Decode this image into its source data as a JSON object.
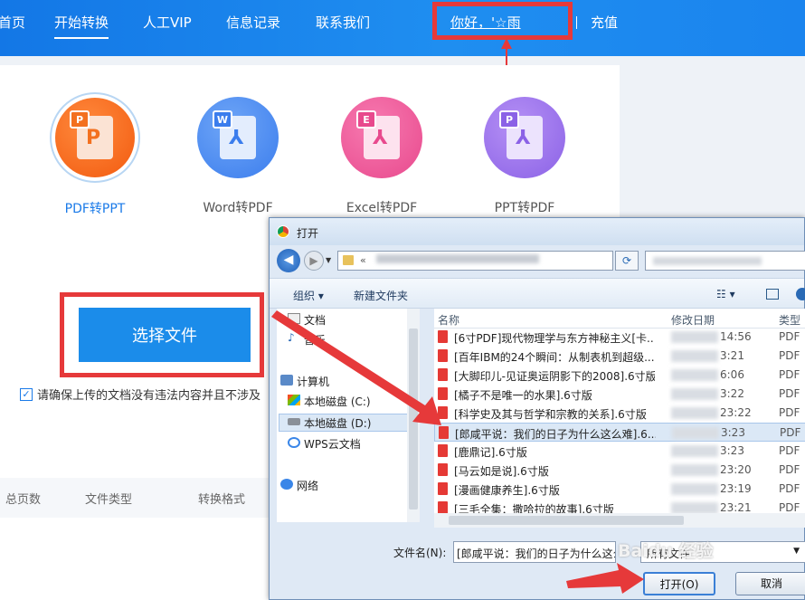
{
  "nav": {
    "items": [
      "首页",
      "开始转换",
      "人工VIP",
      "信息记录",
      "联系我们"
    ],
    "greeting": "你好，'☆雨",
    "recharge": "充值"
  },
  "converters": [
    {
      "label": "PDF转PPT",
      "badge": "P"
    },
    {
      "label": "Word转PDF",
      "badge": "W"
    },
    {
      "label": "Excel转PDF",
      "badge": "E"
    },
    {
      "label": "PPT转PDF",
      "badge": "P"
    }
  ],
  "select_button": "选择文件",
  "agree_text": "请确保上传的文档没有违法内容并且不涉及",
  "table_headers": [
    "总页数",
    "文件类型",
    "转换格式"
  ],
  "dialog": {
    "title": "打开",
    "path_prefix": "«",
    "toolbar": {
      "organize": "组织 ▾",
      "new_folder": "新建文件夹"
    },
    "nav_items": [
      "文档",
      "音乐",
      "计算机",
      "本地磁盘 (C:)",
      "本地磁盘 (D:)",
      "WPS云文档",
      "网络"
    ],
    "columns": [
      "名称",
      "修改日期",
      "类型"
    ],
    "files": [
      {
        "name": "[6寸PDF]现代物理学与东方神秘主义[卡...",
        "date": "14:56",
        "type": "PDF"
      },
      {
        "name": "[百年IBM的24个瞬间：从制表机到超级...",
        "date": "3:21",
        "type": "PDF"
      },
      {
        "name": "[大脚印儿-见证奥运阴影下的2008].6寸版",
        "date": "6:06",
        "type": "PDF"
      },
      {
        "name": "[橘子不是唯一的水果].6寸版",
        "date": "3:22",
        "type": "PDF"
      },
      {
        "name": "[科学史及其与哲学和宗教的关系].6寸版",
        "date": "23:22",
        "type": "PDF"
      },
      {
        "name": "[郎咸平说：我们的日子为什么这么难].6...",
        "date": "3:23",
        "type": "PDF"
      },
      {
        "name": "[鹿鼎记].6寸版",
        "date": "3:23",
        "type": "PDF"
      },
      {
        "name": "[马云如是说].6寸版",
        "date": "23:20",
        "type": "PDF"
      },
      {
        "name": "[漫画健康养生].6寸版",
        "date": "23:19",
        "type": "PDF"
      },
      {
        "name": "[三毛全集：撒哈拉的故事].6寸版",
        "date": "23:21",
        "type": "PDF"
      }
    ],
    "filename_label": "文件名(N):",
    "filename_value": "[郎咸平说：我们的日子为什么这么难",
    "filetype_value": "所有文件",
    "open_button": "打开(O)",
    "cancel_button": "取消"
  },
  "watermark": "Baidu 经验"
}
